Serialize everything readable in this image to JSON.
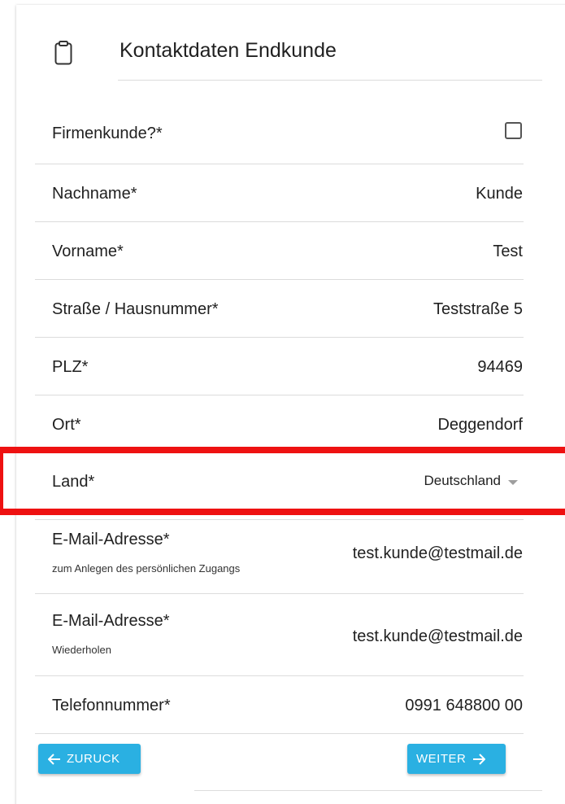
{
  "header": {
    "title": "Kontaktdaten Endkunde",
    "icon": "clipboard-icon"
  },
  "fields": {
    "firmenkunde": {
      "label": "Firmenkunde?*",
      "checked": false
    },
    "nachname": {
      "label": "Nachname*",
      "value": "Kunde"
    },
    "vorname": {
      "label": "Vorname*",
      "value": "Test"
    },
    "strasse": {
      "label": "Straße / Hausnummer*",
      "value": "Teststraße 5"
    },
    "plz": {
      "label": "PLZ*",
      "value": "94469"
    },
    "ort": {
      "label": "Ort*",
      "value": "Deggendorf"
    },
    "land": {
      "label": "Land*",
      "value": "Deutschland"
    },
    "email": {
      "label": "E-Mail-Adresse*",
      "sublabel": "zum Anlegen des persönlichen Zugangs",
      "value": "test.kunde@testmail.de"
    },
    "email_repeat": {
      "label": "E-Mail-Adresse*",
      "sublabel": "Wiederholen",
      "value": "test.kunde@testmail.de"
    },
    "telefon": {
      "label": "Telefonnummer*",
      "value": "0991 648800 00"
    }
  },
  "buttons": {
    "back": "ZURUCK",
    "next": "WEITER"
  },
  "colors": {
    "accent": "#2ab0e2",
    "highlight": "#ee1111"
  }
}
